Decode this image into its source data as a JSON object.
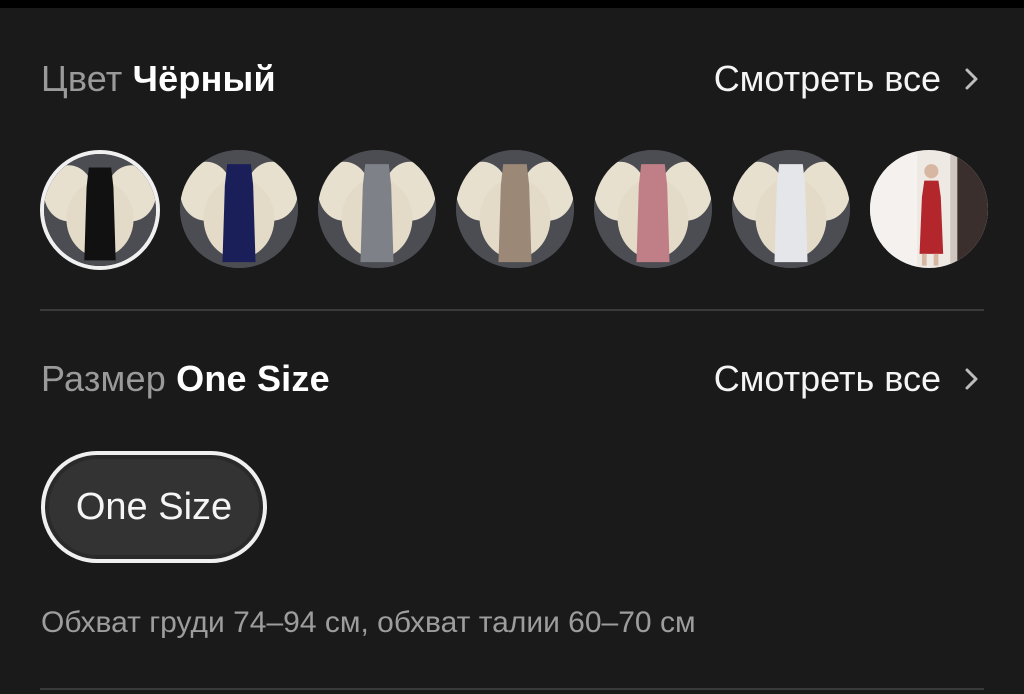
{
  "color_section": {
    "label": "Цвет",
    "selected_value": "Чёрный",
    "see_all": "Смотреть все",
    "swatches": [
      {
        "name": "black",
        "color": "#111111"
      },
      {
        "name": "navy",
        "color": "#1a1f5a"
      },
      {
        "name": "gray",
        "color": "#7e8288"
      },
      {
        "name": "taupe",
        "color": "#9b8877"
      },
      {
        "name": "pink",
        "color": "#c07e86"
      },
      {
        "name": "white",
        "color": "#e4e6ea"
      },
      {
        "name": "red-photo",
        "color": "#b3262c"
      }
    ]
  },
  "size_section": {
    "label": "Размер",
    "selected_value": "One Size",
    "see_all": "Смотреть все",
    "options": [
      "One Size"
    ],
    "measurements": "Обхват груди 74–94 см, обхват талии 60–70 см"
  }
}
